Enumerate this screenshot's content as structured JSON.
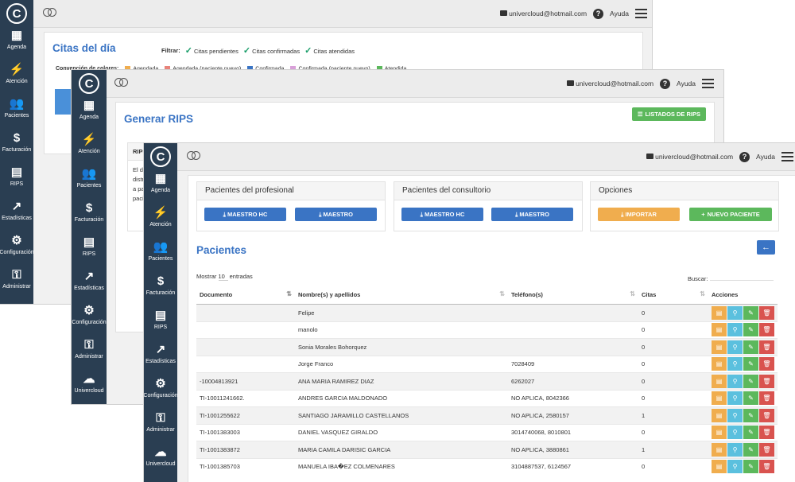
{
  "sidebar": {
    "logo": "C",
    "items": [
      {
        "label": "Agenda",
        "icon": "calendar-icon",
        "glyph": "▦"
      },
      {
        "label": "Atención",
        "icon": "bolt-icon",
        "glyph": "⚡"
      },
      {
        "label": "Pacientes",
        "icon": "users-icon",
        "glyph": "👥"
      },
      {
        "label": "Facturación",
        "icon": "dollar-icon",
        "glyph": "$"
      },
      {
        "label": "RIPS",
        "icon": "file-icon",
        "glyph": "▤"
      },
      {
        "label": "Estadísticas",
        "icon": "chart-icon",
        "glyph": "↗"
      },
      {
        "label": "Configuración",
        "icon": "gears-icon",
        "glyph": "⚙"
      },
      {
        "label": "Administrar",
        "icon": "key-icon",
        "glyph": "⚿"
      },
      {
        "label": "Univercloud",
        "icon": "cloud-icon",
        "glyph": "☁"
      }
    ]
  },
  "topbar": {
    "email": "univercloud@hotmail.com",
    "help": "Ayuda",
    "help_glyph": "?"
  },
  "win1": {
    "title": "Citas del día",
    "filter_label": "Filtrar:",
    "filters": [
      "Citas pendientes",
      "Citas confirmadas",
      "Citas atendidas"
    ],
    "legend_label": "Convención de colores:",
    "legend": [
      {
        "label": "Agendada",
        "color": "#f0ad4e"
      },
      {
        "label": "Agendada (paciente nuevo)",
        "color": "#e8837a"
      },
      {
        "label": "Confirmada",
        "color": "#3a74c4"
      },
      {
        "label": "Confirmada (paciente nuevo)",
        "color": "#d9a0d9"
      },
      {
        "label": "Atendida",
        "color": "#5cb85c"
      }
    ]
  },
  "win2": {
    "title": "Generar RIPS",
    "list_button": "LISTADOS DE RIPS",
    "panel_head": "RIPS",
    "panel_text": [
      "El d",
      "distr",
      "a pa",
      "pacie"
    ]
  },
  "win3": {
    "sections": [
      {
        "title": "Pacientes del profesional",
        "buttons": [
          "MAESTRO HC",
          "MAESTRO"
        ]
      },
      {
        "title": "Pacientes del consultorio",
        "buttons": [
          "MAESTRO HC",
          "MAESTRO"
        ]
      },
      {
        "title": "Opciones",
        "buttons": [
          "IMPORTAR",
          "NUEVO PACIENTE"
        ]
      }
    ],
    "title": "Pacientes",
    "show_label": "Mostrar",
    "show_value": "10",
    "entries_label": "entradas",
    "search_label": "Buscar:",
    "columns": [
      "Documento",
      "Nombre(s) y apellidos",
      "Teléfono(s)",
      "Citas",
      "Acciones"
    ],
    "rows": [
      {
        "doc": "",
        "name": "Felipe",
        "phone": "",
        "citas": "0"
      },
      {
        "doc": "",
        "name": "manolo",
        "phone": "",
        "citas": "0"
      },
      {
        "doc": "",
        "name": "Sonia Morales Bohorquez",
        "phone": "",
        "citas": "0"
      },
      {
        "doc": "",
        "name": "Jorge Franco",
        "phone": "7028409",
        "citas": "0"
      },
      {
        "doc": "-10004813921",
        "name": "ANA MARIA RAMIREZ DIAZ",
        "phone": "6262027",
        "citas": "0"
      },
      {
        "doc": "TI-10011241662.",
        "name": "ANDRES GARCIA MALDONADO",
        "phone": "NO APLICA, 8042366",
        "citas": "0"
      },
      {
        "doc": "TI-1001255622",
        "name": "SANTIAGO JARAMILLO CASTELLANOS",
        "phone": "NO APLICA, 2580157",
        "citas": "1"
      },
      {
        "doc": "TI-1001383003",
        "name": "DANIEL VASQUEZ GIRALDO",
        "phone": "3014740068, 8010801",
        "citas": "0"
      },
      {
        "doc": "TI-1001383872",
        "name": "MARIA CAMILA DARISIC GARCIA",
        "phone": "NO APLICA, 3880861",
        "citas": "1"
      },
      {
        "doc": "TI-1001385703",
        "name": "MANUELA IBA�EZ COLMENARES",
        "phone": "3104887537, 6124567",
        "citas": "0"
      }
    ]
  }
}
